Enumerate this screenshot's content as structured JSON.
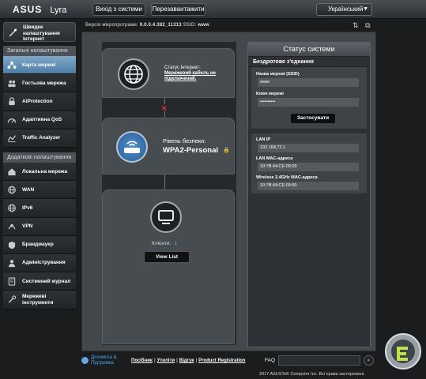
{
  "header": {
    "brand": "ASUS",
    "model": "Lyra",
    "logout_label": "Вихід з системи",
    "reboot_label": "Перезавантажити",
    "language": "Український"
  },
  "sidebar": {
    "quick_setup": "Швидке налаштування Інтернет",
    "general_title": "Загальні налаштування",
    "general_items": [
      {
        "label": "Карта мережі",
        "icon": "network-map-icon",
        "active": true
      },
      {
        "label": "Гостьова мережа",
        "icon": "guest-network-icon",
        "active": false
      },
      {
        "label": "AiProtection",
        "icon": "lock-icon",
        "active": false
      },
      {
        "label": "Адаптивна QoS",
        "icon": "speedometer-icon",
        "active": false
      },
      {
        "label": "Traffic Analyzer",
        "icon": "analyzer-icon",
        "active": false
      }
    ],
    "advanced_title": "Додаткові налаштування",
    "advanced_items": [
      {
        "label": "Локальна мережа",
        "icon": "home-icon"
      },
      {
        "label": "WAN",
        "icon": "globe-icon"
      },
      {
        "label": "IPv6",
        "icon": "globe-icon"
      },
      {
        "label": "VPN",
        "icon": "vpn-icon"
      },
      {
        "label": "Брандмауер",
        "icon": "firewall-icon"
      },
      {
        "label": "Адміністрування",
        "icon": "admin-icon"
      },
      {
        "label": "Системний журнал",
        "icon": "log-icon"
      },
      {
        "label": "Мережеві інструменти",
        "icon": "tools-icon"
      }
    ]
  },
  "firmware": {
    "label": "Версія мікропрограми:",
    "version": "9.0.0.4.382_11313",
    "ssid_label": "SSID:",
    "ssid": "www"
  },
  "network_map": {
    "internet_status_label": "Статус Інтернет:",
    "internet_status_value": "Мережевий кабель не підключений.",
    "security_label": "Рівень безпеки:",
    "security_value": "WPA2-Personal",
    "clients_label": "Клієнти:",
    "clients_count": "1",
    "view_list": "View List"
  },
  "status_panel": {
    "title": "Статус системи",
    "wireless_title": "Бездротове з'єднання",
    "ssid_label": "Назва мережі (SSID)",
    "ssid_value": "www",
    "key_label": "Ключ мережі",
    "key_value": "••••••••••",
    "apply": "Застосувати",
    "lan_ip_label": "LAN IP",
    "lan_ip": "192.168.72.1",
    "lan_mac_label": "LAN MAC-адреса",
    "lan_mac": "10:7B:44:CE:09:03",
    "wl_mac_label": "Wireless 2.4GHz MAC-адреса",
    "wl_mac": "10:7B:44:CE:09:00"
  },
  "footer": {
    "help": "Допомога & Підтримка",
    "manual": "Посібник",
    "utility": "Утиліти",
    "feedback": "Відгук",
    "registration": "Product Registration",
    "sep": "|",
    "faq": "FAQ",
    "copyright": "2017 ASUSTeK Computer Inc. Всі права застережені."
  },
  "colors": {
    "accent": "#4f7ea6",
    "link": "#4ea3f5"
  }
}
